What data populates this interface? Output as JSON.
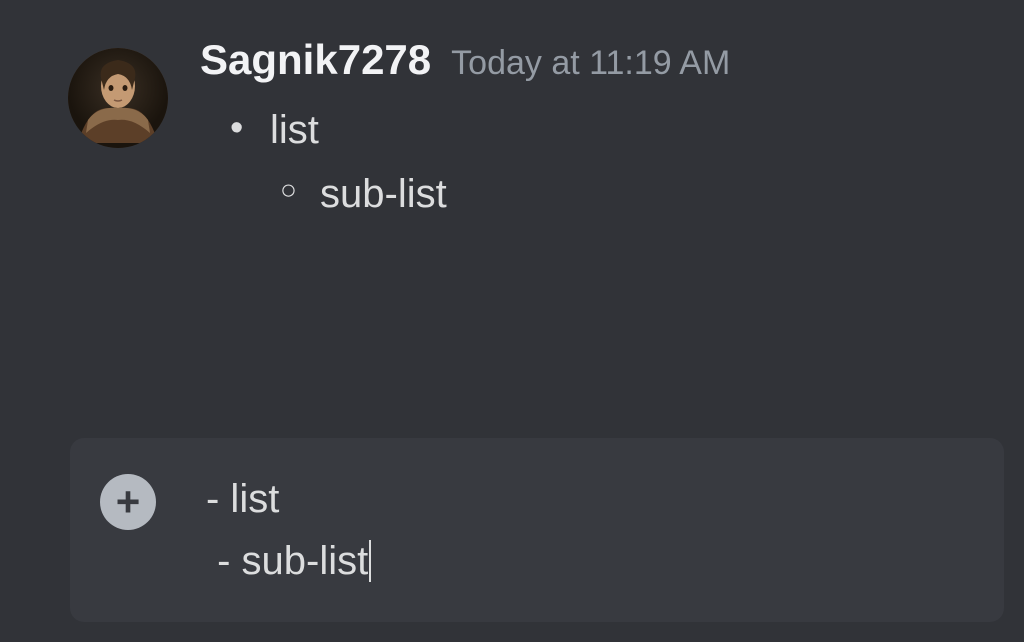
{
  "message": {
    "username": "Sagnik7278",
    "timestamp": "Today at 11:19 AM",
    "list": {
      "item": "list",
      "subitem": "sub-list"
    }
  },
  "input": {
    "line1": "- list",
    "line2": " - sub-list"
  }
}
